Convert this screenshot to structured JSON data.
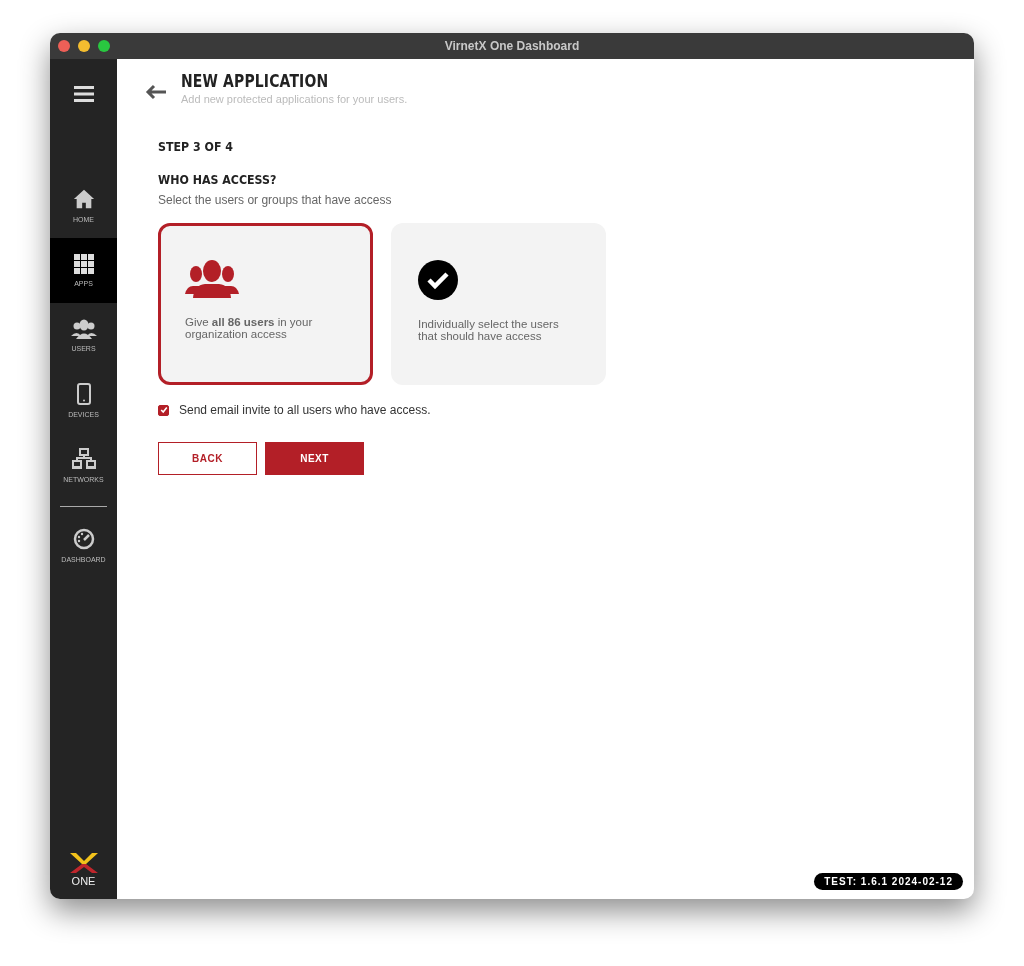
{
  "window": {
    "title": "VirnetX One Dashboard"
  },
  "sidebar": {
    "items": [
      {
        "kind": "home",
        "label": "HOME",
        "selected": false
      },
      {
        "kind": "apps",
        "label": "APPS",
        "selected": true
      },
      {
        "kind": "users",
        "label": "USERS",
        "selected": false
      },
      {
        "kind": "devices",
        "label": "DEVICES",
        "selected": false
      },
      {
        "kind": "networks",
        "label": "NETWORKS",
        "selected": false
      },
      {
        "kind": "divider"
      },
      {
        "kind": "dashboard",
        "label": "DASHBOARD",
        "selected": false
      }
    ],
    "logo_text": "ONE"
  },
  "header": {
    "title": "NEW APPLICATION",
    "subtitle": "Add new protected applications for your users."
  },
  "step": "STEP 3 OF 4",
  "section": {
    "title": "WHO HAS ACCESS?",
    "description": "Select the users or groups that have access"
  },
  "options": [
    {
      "kind": "all",
      "text": "Give **all 86 users** in your organization access",
      "selected": true
    },
    {
      "kind": "individual",
      "text": "Individually select the users that should have access",
      "selected": false
    }
  ],
  "email_invite": {
    "label": "Send email invite to all users who have access.",
    "checked": true
  },
  "buttons": [
    {
      "kind": "secondary",
      "label": "BACK"
    },
    {
      "kind": "primary",
      "label": "NEXT"
    }
  ],
  "version_badge": "TEST: 1.6.1 2024-02-12"
}
